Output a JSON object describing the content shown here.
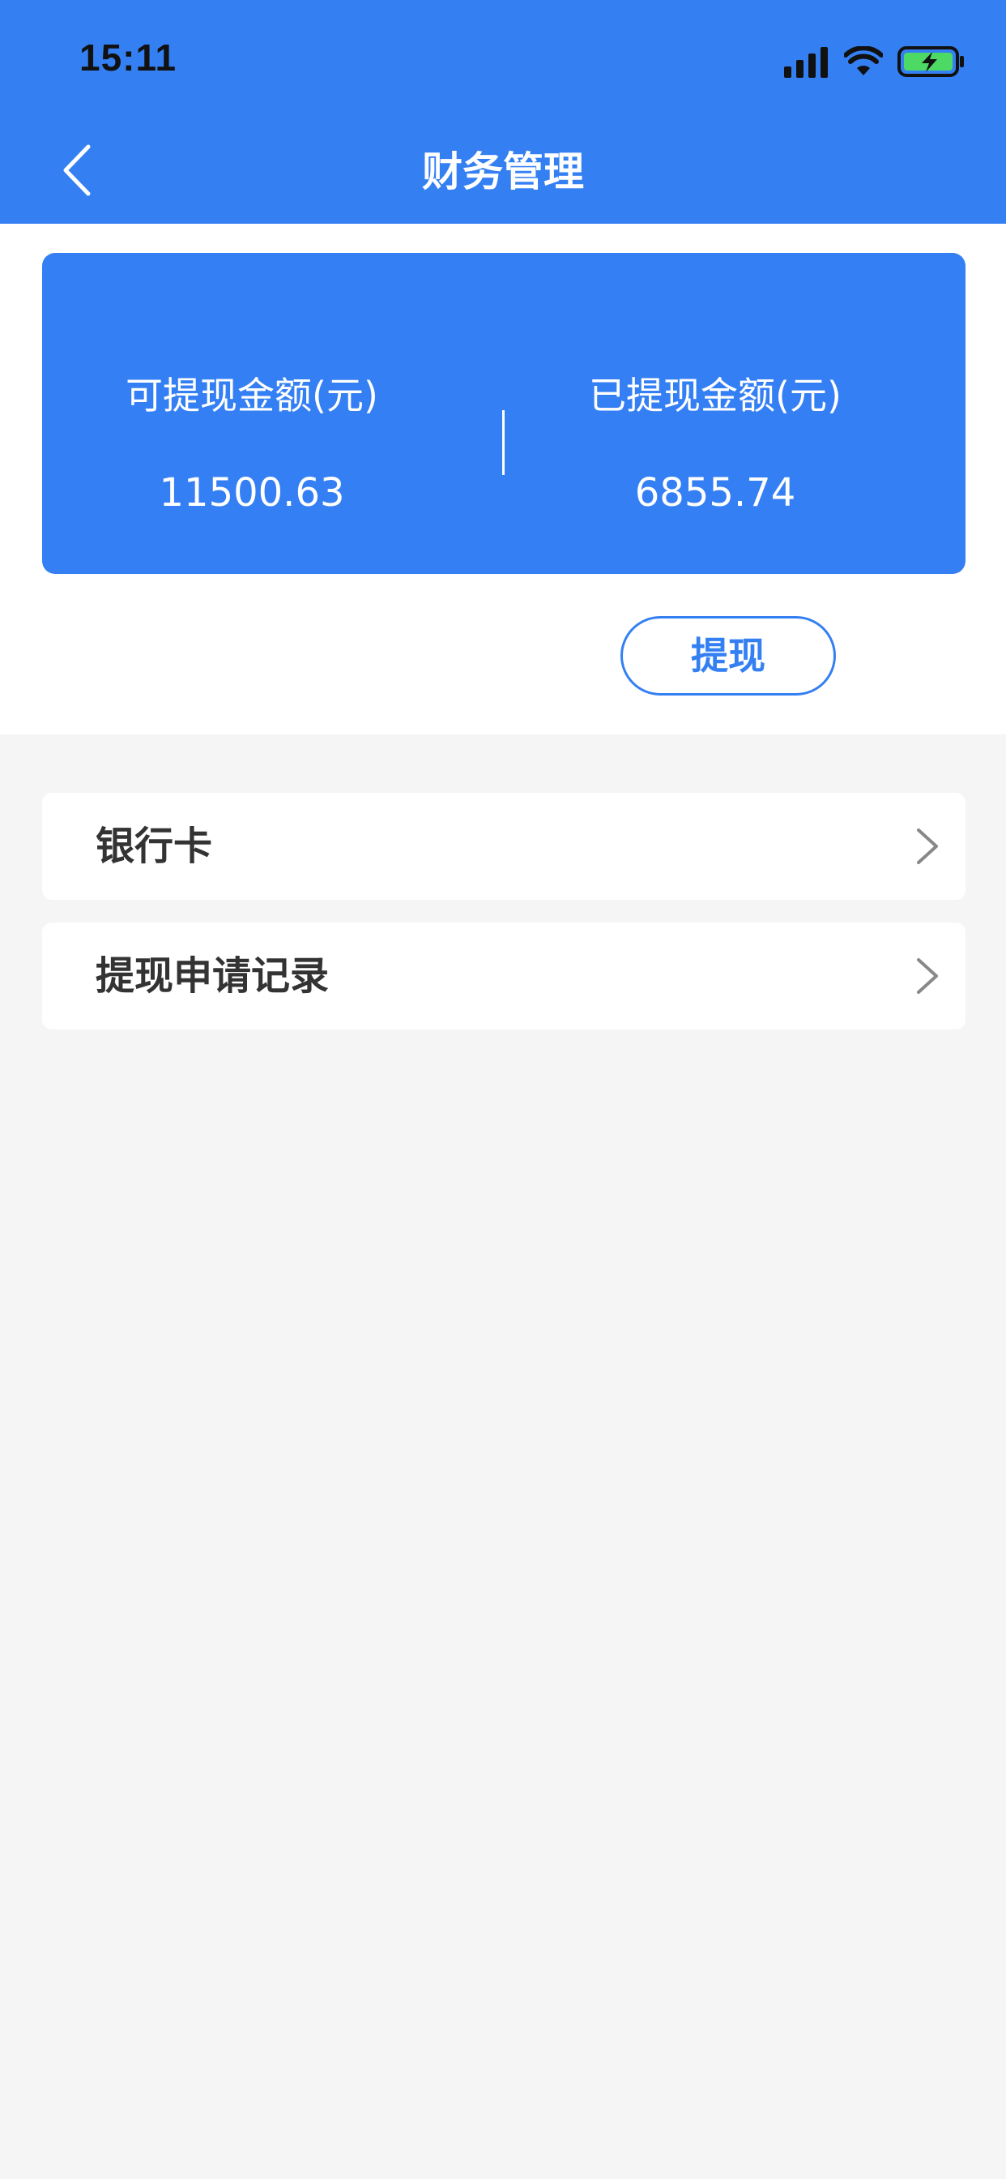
{
  "status_bar": {
    "time": "15:11"
  },
  "header": {
    "title": "财务管理",
    "background_color": "#3480f3"
  },
  "balance_card": {
    "available": {
      "label": "可提现金额(元)",
      "value": "11500.63"
    },
    "withdrawn": {
      "label": "已提现金额(元)",
      "value": "6855.74"
    }
  },
  "withdraw_button": {
    "label": "提现"
  },
  "menu": {
    "items": [
      {
        "label": "银行卡",
        "icon": "chevron-right-icon"
      },
      {
        "label": "提现申请记录",
        "icon": "chevron-right-icon"
      }
    ]
  },
  "colors": {
    "accent": "#3480f3",
    "page_background": "#f5f5f5",
    "battery_fill": "#4cd964"
  }
}
